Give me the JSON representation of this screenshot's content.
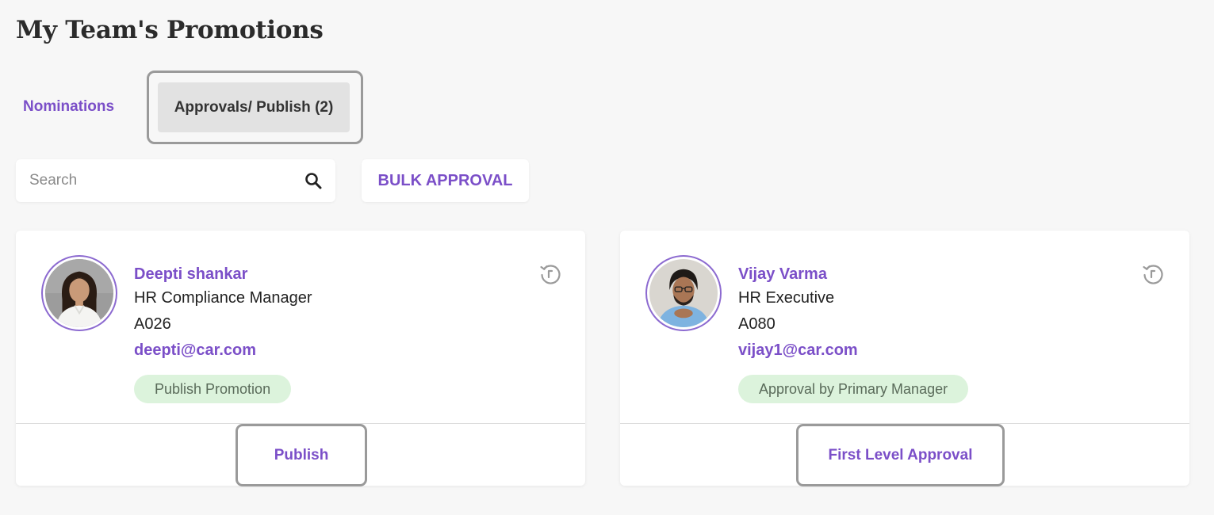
{
  "page": {
    "title": "My Team's Promotions"
  },
  "tabs": [
    {
      "label": "Nominations"
    },
    {
      "label": "Approvals/ Publish (2)"
    }
  ],
  "search": {
    "placeholder": "Search",
    "value": ""
  },
  "toolbar": {
    "bulk_approval_label": "BULK APPROVAL"
  },
  "cards": [
    {
      "name": "Deepti shankar",
      "role": "HR Compliance Manager",
      "code": "A026",
      "email": "deepti@car.com",
      "status": "Publish Promotion",
      "action": "Publish"
    },
    {
      "name": "Vijay Varma",
      "role": "HR Executive",
      "code": "A080",
      "email": "vijay1@car.com",
      "status": "Approval by Primary Manager",
      "action": "First Level Approval"
    }
  ],
  "colors": {
    "accent": "#7b4fc8",
    "badge_bg": "#dcf3dc",
    "page_bg": "#f7f7f7"
  },
  "icons": [
    "search-icon",
    "history-icon"
  ]
}
